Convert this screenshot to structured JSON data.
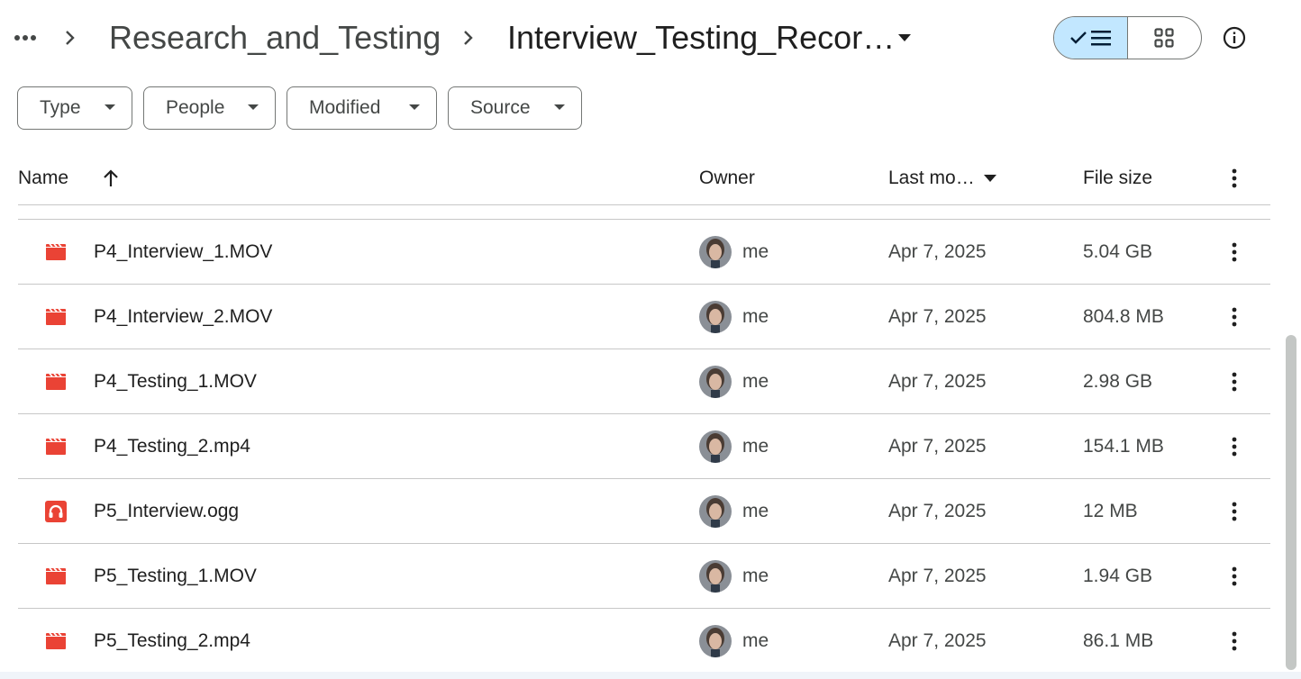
{
  "breadcrumb": {
    "more_label": "•••",
    "parent": "Research_and_Testing",
    "current": "Interview_Testing_Recor…"
  },
  "view_toggle": {
    "list_selected": true
  },
  "filters": [
    {
      "label": "Type"
    },
    {
      "label": "People"
    },
    {
      "label": "Modified"
    },
    {
      "label": "Source"
    }
  ],
  "table": {
    "headers": {
      "name": "Name",
      "owner": "Owner",
      "modified": "Last mo…",
      "size": "File size"
    },
    "rows": [
      {
        "name": "P4_Interview_1.MOV",
        "type": "video",
        "owner": "me",
        "modified": "Apr 7, 2025",
        "size": "5.04 GB"
      },
      {
        "name": "P4_Interview_2.MOV",
        "type": "video",
        "owner": "me",
        "modified": "Apr 7, 2025",
        "size": "804.8 MB"
      },
      {
        "name": "P4_Testing_1.MOV",
        "type": "video",
        "owner": "me",
        "modified": "Apr 7, 2025",
        "size": "2.98 GB"
      },
      {
        "name": "P4_Testing_2.mp4",
        "type": "video",
        "owner": "me",
        "modified": "Apr 7, 2025",
        "size": "154.1 MB"
      },
      {
        "name": "P5_Interview.ogg",
        "type": "audio",
        "owner": "me",
        "modified": "Apr 7, 2025",
        "size": "12 MB"
      },
      {
        "name": "P5_Testing_1.MOV",
        "type": "video",
        "owner": "me",
        "modified": "Apr 7, 2025",
        "size": "1.94 GB"
      },
      {
        "name": "P5_Testing_2.mp4",
        "type": "video",
        "owner": "me",
        "modified": "Apr 7, 2025",
        "size": "86.1 MB"
      }
    ]
  },
  "colors": {
    "file_icon": "#ea4335",
    "toggle_active": "#c2e7ff",
    "divider": "#c7c7c7"
  }
}
